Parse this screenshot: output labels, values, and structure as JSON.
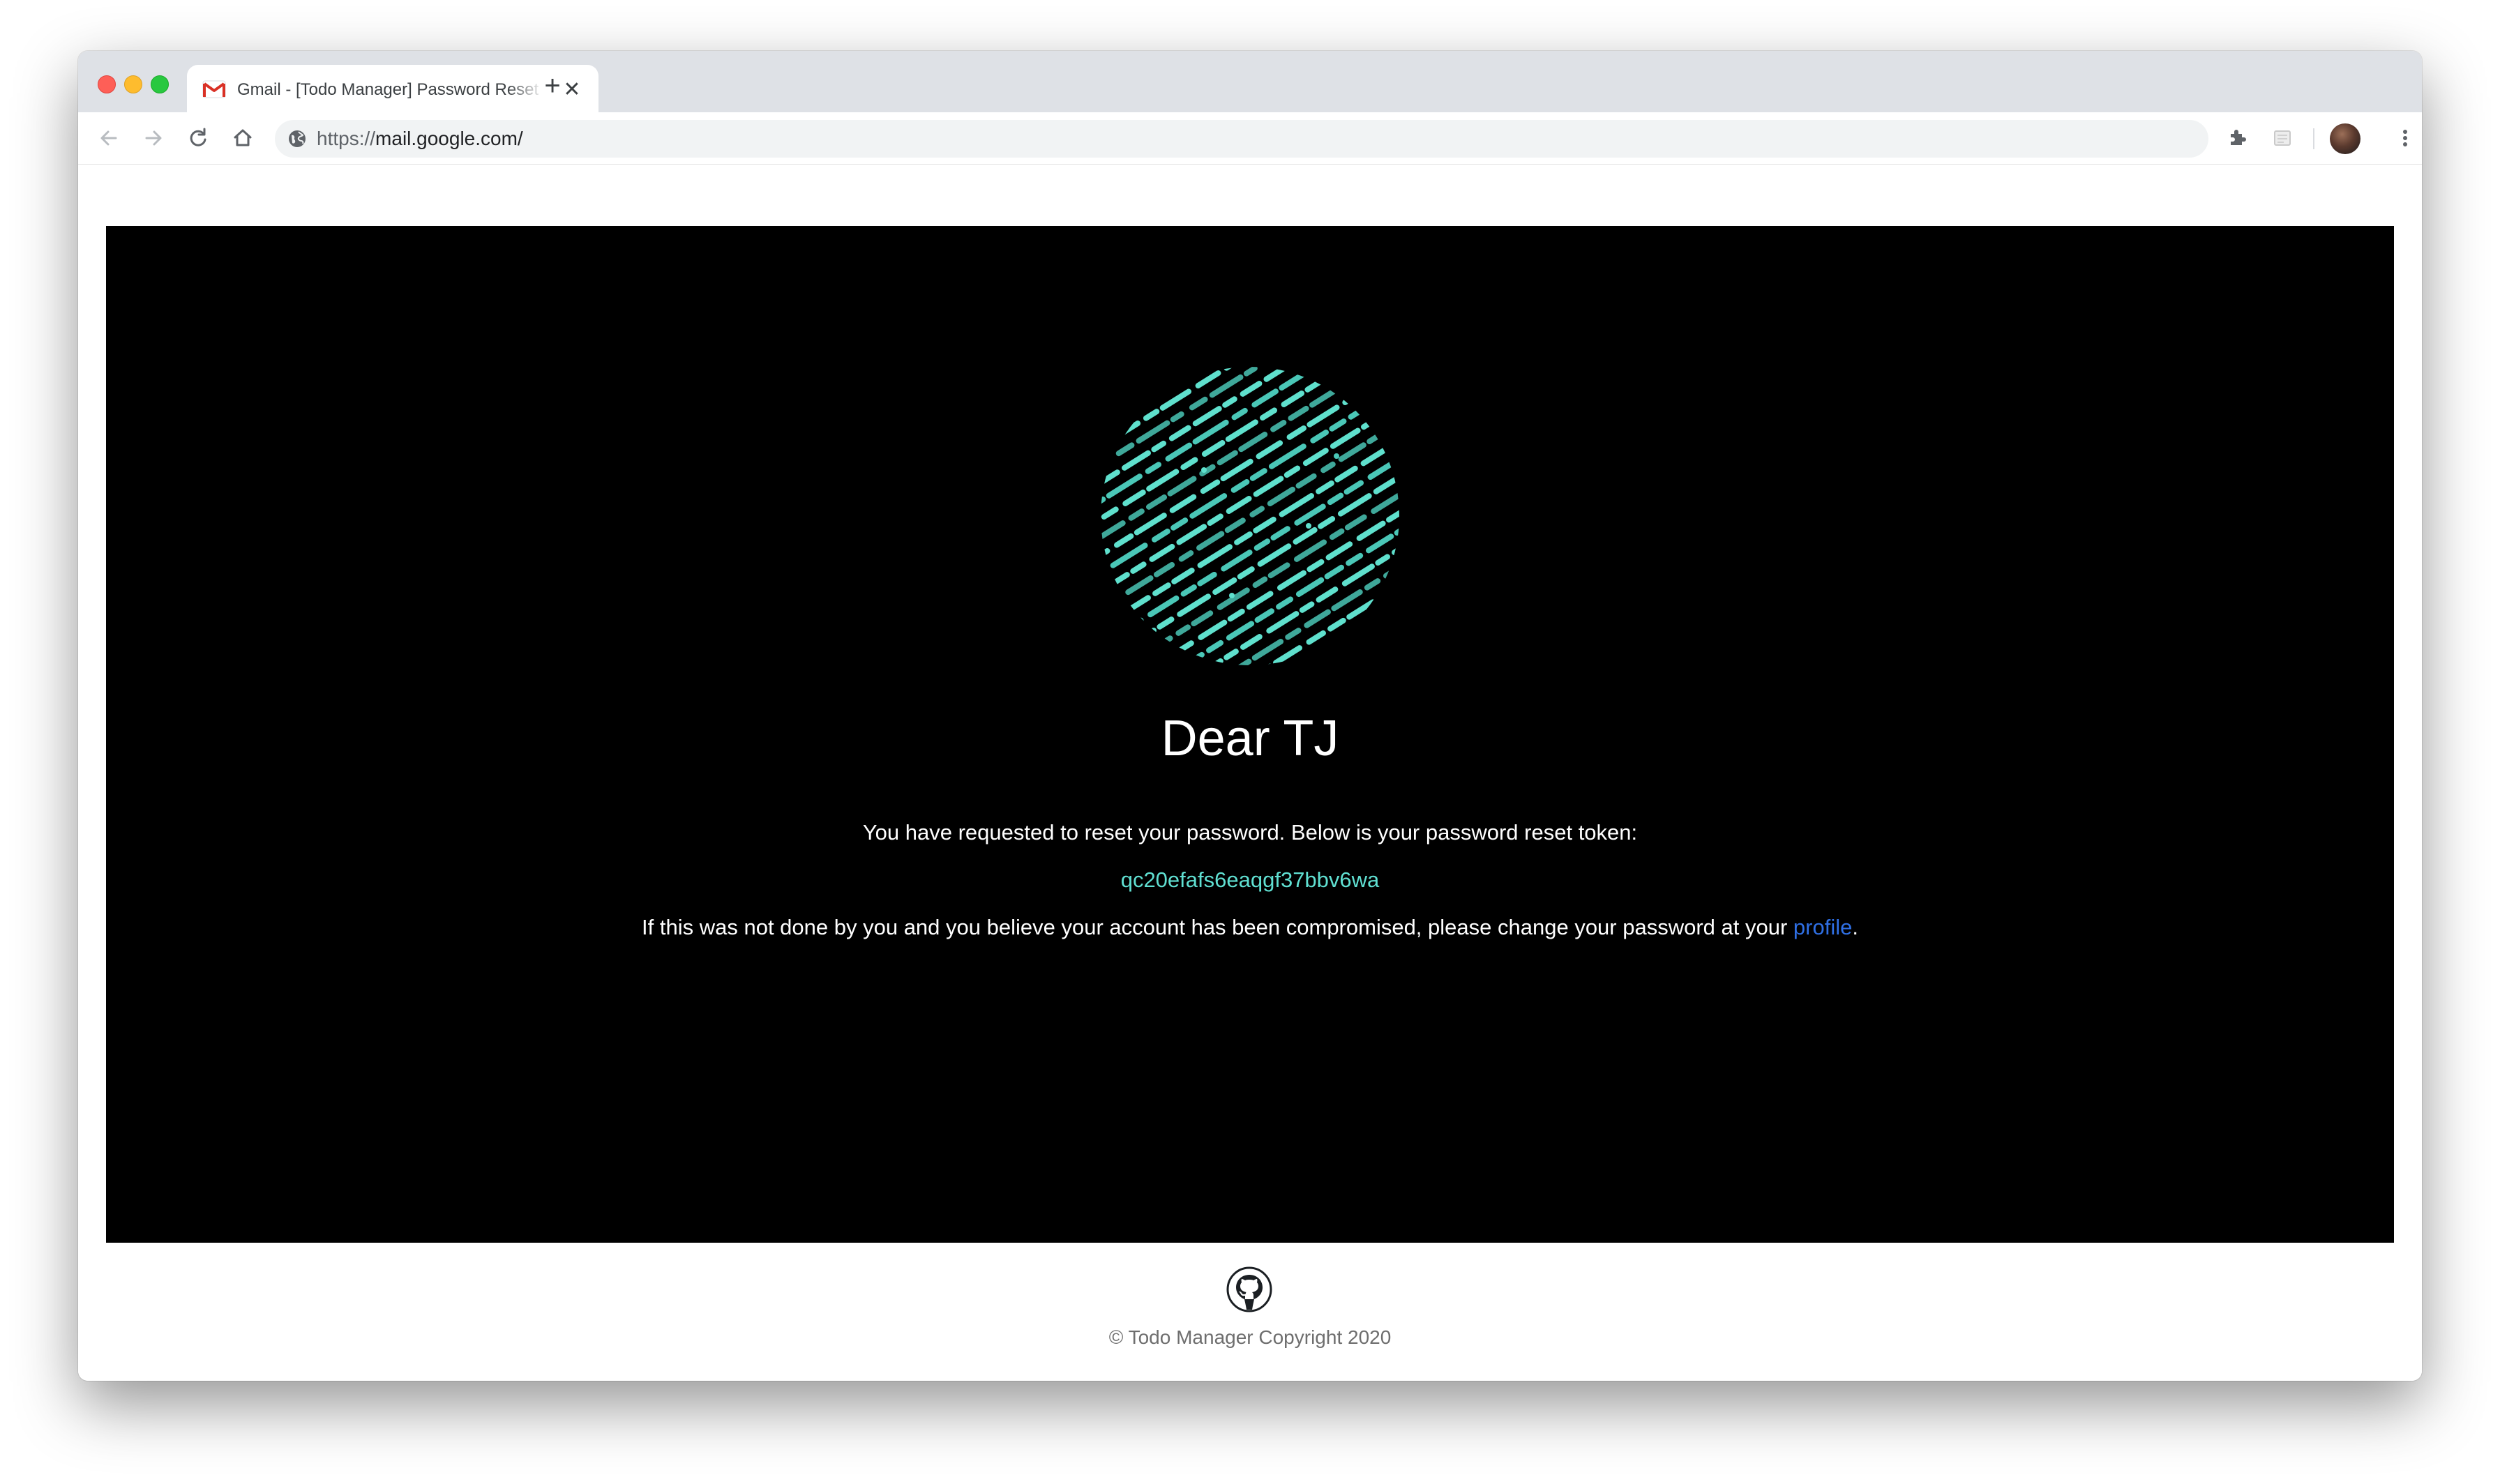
{
  "browser": {
    "tab": {
      "title": "Gmail - [Todo Manager] Password Reset",
      "favicon": "gmail-icon",
      "close_glyph": "✕"
    },
    "new_tab_glyph": "+",
    "address": {
      "scheme": "https://",
      "host_path": "mail.google.com/",
      "security_icon": "globe-icon"
    },
    "toolbar_icons": [
      "back-icon",
      "forward-icon",
      "reload-icon",
      "home-icon",
      "extensions-icon",
      "extension-icon",
      "profile-avatar",
      "menu-icon"
    ]
  },
  "email": {
    "greeting": "Dear TJ",
    "intro": "You have requested to reset your password. Below is your password reset token:",
    "token": "qc20efafs6eaqgf37bbv6wa",
    "warning_before_link": "If this was not done by you and you believe your account has been compromised, please change your password at your ",
    "warning_link": "profile",
    "warning_after_link": ".",
    "token_color": "#60e0d2",
    "link_color": "#2f6fe4",
    "panel_color": "#000000"
  },
  "footer": {
    "icon": "github-icon",
    "copyright": "© Todo Manager Copyright 2020"
  }
}
